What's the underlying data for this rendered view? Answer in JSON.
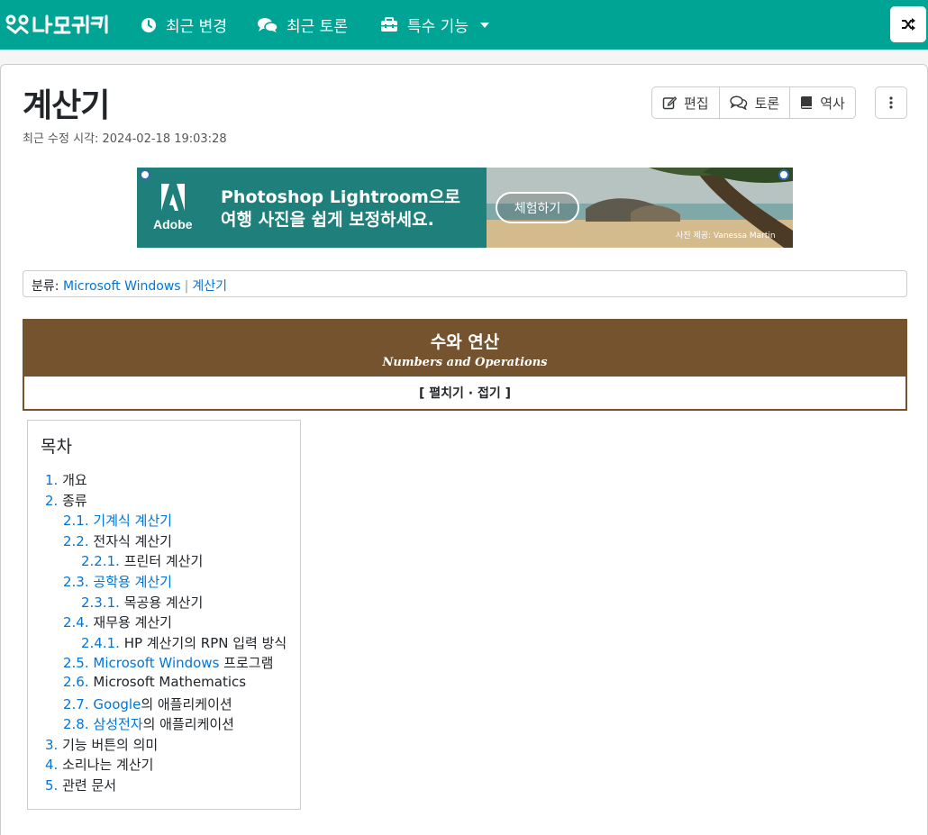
{
  "nav": {
    "logo": "나무위키",
    "recent_changes": "최근 변경",
    "recent_discuss": "최근 토론",
    "special": "특수 기능"
  },
  "page": {
    "title": "계산기",
    "last_modified": "최근 수정 시각: 2024-02-18 19:03:28"
  },
  "actions": {
    "edit": "편집",
    "discuss": "토론",
    "history": "역사"
  },
  "ad": {
    "brand": "Adobe",
    "line1": "Photoshop Lightroom으로",
    "line2": "여행 사진을 쉽게 보정하세요.",
    "cta": "체험하기",
    "credit": "사진 제공: Vanessa Martin"
  },
  "category": {
    "label": "분류:",
    "items": [
      "Microsoft Windows",
      "계산기"
    ]
  },
  "navbox": {
    "title": "수와 연산",
    "subtitle": "Numbers and Operations",
    "toggle": "[ 펼치기 · 접기 ]"
  },
  "toc": {
    "title": "목차",
    "items": [
      {
        "num": "1.",
        "pre": "",
        "link": "",
        "post": "개요"
      },
      {
        "num": "2.",
        "pre": "",
        "link": "",
        "post": "종류"
      },
      {
        "num": "2.1.",
        "pre": "",
        "link": "기계식 계산기",
        "post": ""
      },
      {
        "num": "2.2.",
        "pre": "",
        "link": "",
        "post": "전자식 계산기"
      },
      {
        "num": "2.2.1.",
        "pre": "",
        "link": "",
        "post": "프린터 계산기"
      },
      {
        "num": "2.3.",
        "pre": "",
        "link": "공학용 계산기",
        "post": ""
      },
      {
        "num": "2.3.1.",
        "pre": "",
        "link": "",
        "post": "목공용 계산기"
      },
      {
        "num": "2.4.",
        "pre": "",
        "link": "",
        "post": "재무용 계산기"
      },
      {
        "num": "2.4.1.",
        "pre": "",
        "link": "",
        "post": "HP 계산기의 RPN 입력 방식"
      },
      {
        "num": "2.5.",
        "pre": "",
        "link": "Microsoft Windows",
        "post": " 프로그램"
      },
      {
        "num": "2.6.",
        "pre": "",
        "link": "",
        "post": "Microsoft Mathematics"
      },
      {
        "num": "2.7.",
        "pre": "",
        "link": "Google",
        "post": "의 애플리케이션"
      },
      {
        "num": "2.8.",
        "pre": "",
        "link": "삼성전자",
        "post": "의 애플리케이션"
      },
      {
        "num": "3.",
        "pre": "",
        "link": "",
        "post": "기능 버튼의 의미"
      },
      {
        "num": "4.",
        "pre": "",
        "link": "",
        "post": "소리나는 계산기"
      },
      {
        "num": "5.",
        "pre": "",
        "link": "",
        "post": "관련 문서"
      }
    ]
  },
  "colors": {
    "nav_bg": "#00a495",
    "navbox_bg": "#75532e",
    "link": "#0275d8"
  }
}
